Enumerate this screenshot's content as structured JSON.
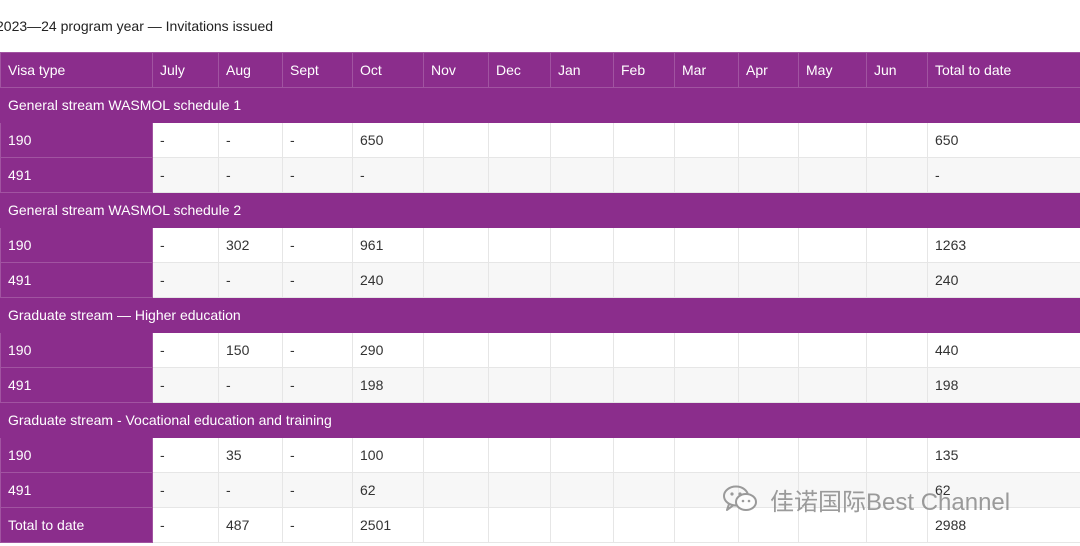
{
  "caption": "2023—24 program year — Invitations issued",
  "columns": [
    "Visa type",
    "July",
    "Aug",
    "Sept",
    "Oct",
    "Nov",
    "Dec",
    "Jan",
    "Feb",
    "Mar",
    "Apr",
    "May",
    "Jun",
    "Total to date"
  ],
  "sections": [
    {
      "title": "General stream WASMOL schedule 1",
      "rows": [
        {
          "visa": "190",
          "cells": [
            "-",
            "-",
            "-",
            "650",
            "",
            "",
            "",
            "",
            "",
            "",
            "",
            "",
            "650"
          ]
        },
        {
          "visa": "491",
          "cells": [
            "-",
            "-",
            "-",
            "-",
            "",
            "",
            "",
            "",
            "",
            "",
            "",
            "",
            "-"
          ]
        }
      ]
    },
    {
      "title": "General stream WASMOL schedule 2",
      "rows": [
        {
          "visa": "190",
          "cells": [
            "-",
            "302",
            "-",
            "961",
            "",
            "",
            "",
            "",
            "",
            "",
            "",
            "",
            "1263"
          ]
        },
        {
          "visa": "491",
          "cells": [
            "-",
            "-",
            "-",
            "240",
            "",
            "",
            "",
            "",
            "",
            "",
            "",
            "",
            "240"
          ]
        }
      ]
    },
    {
      "title": "Graduate stream — Higher education",
      "rows": [
        {
          "visa": "190",
          "cells": [
            "-",
            "150",
            "-",
            "290",
            "",
            "",
            "",
            "",
            "",
            "",
            "",
            "",
            "440"
          ]
        },
        {
          "visa": "491",
          "cells": [
            "-",
            "-",
            "-",
            "198",
            "",
            "",
            "",
            "",
            "",
            "",
            "",
            "",
            "198"
          ]
        }
      ]
    },
    {
      "title": "Graduate stream - Vocational education and training",
      "rows": [
        {
          "visa": "190",
          "cells": [
            "-",
            "35",
            "-",
            "100",
            "",
            "",
            "",
            "",
            "",
            "",
            "",
            "",
            "135"
          ]
        },
        {
          "visa": "491",
          "cells": [
            "-",
            "-",
            "-",
            "62",
            "",
            "",
            "",
            "",
            "",
            "",
            "",
            "",
            "62"
          ]
        }
      ]
    }
  ],
  "total_row": {
    "label": "Total to date",
    "cells": [
      "-",
      "487",
      "-",
      "2501",
      "",
      "",
      "",
      "",
      "",
      "",
      "",
      "",
      "2988"
    ]
  },
  "watermark": {
    "text": "佳诺国际Best Channel",
    "icon": "wechat-icon"
  }
}
